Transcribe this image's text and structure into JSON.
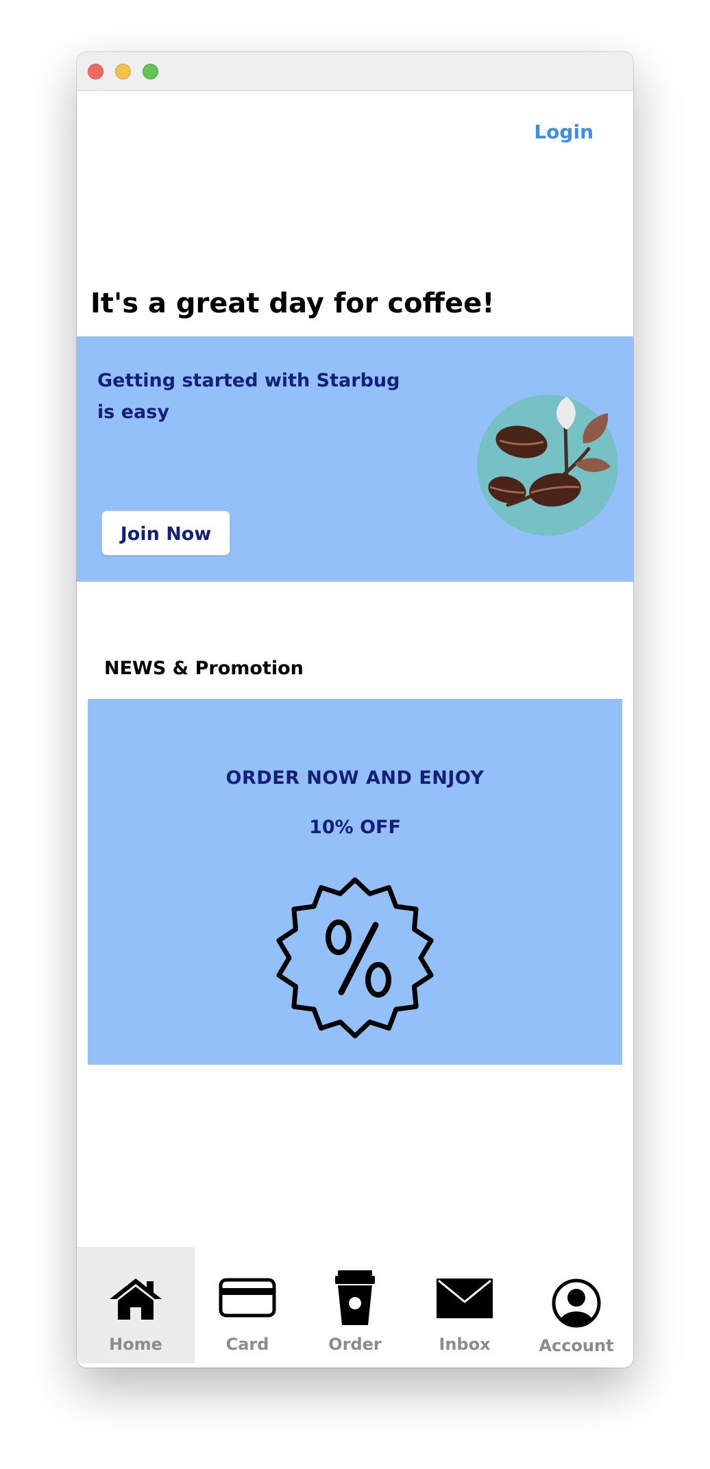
{
  "header": {
    "login_label": "Login"
  },
  "greeting": "It's a great day for coffee!",
  "hero": {
    "text": "Getting started with Starbug is easy",
    "button_label": "Join Now",
    "icon": "coffee-beans-icon"
  },
  "news": {
    "title": "NEWS & Promotion",
    "promo_line1": "ORDER NOW AND ENJOY",
    "promo_line2": "10% OFF",
    "icon": "percent-badge-icon"
  },
  "tabs": [
    {
      "label": "Home",
      "icon": "home-icon",
      "active": true
    },
    {
      "label": "Card",
      "icon": "card-icon",
      "active": false
    },
    {
      "label": "Order",
      "icon": "cup-icon",
      "active": false
    },
    {
      "label": "Inbox",
      "icon": "mail-icon",
      "active": false
    },
    {
      "label": "Account",
      "icon": "account-icon",
      "active": false
    }
  ],
  "colors": {
    "banner_bg": "#94c0f9",
    "banner_text": "#141f7a",
    "login_link": "#3d8ee6",
    "tab_label": "#8c8c8c",
    "active_tab_bg": "#ececec"
  }
}
